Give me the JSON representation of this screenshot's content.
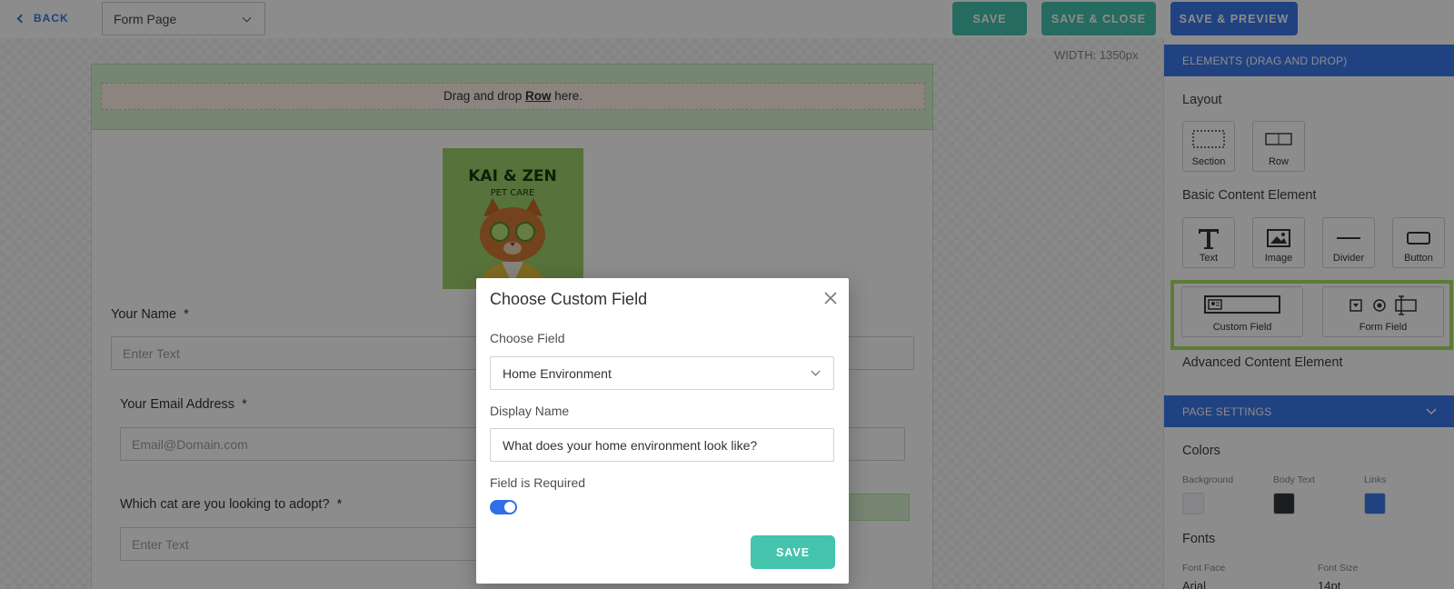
{
  "topbar": {
    "back_label": "BACK",
    "page_select_value": "Form Page",
    "save_label": "SAVE",
    "save_close_label": "SAVE & CLOSE",
    "save_preview_label": "SAVE & PREVIEW"
  },
  "canvas": {
    "width_label": "WIDTH: 1350px",
    "dropzone_prefix": "Drag and drop ",
    "dropzone_bold": "Row",
    "dropzone_suffix": " here.",
    "logo_line1": "KAI & ZEN",
    "logo_line2": "PET CARE",
    "fields": [
      {
        "label": "Your Name",
        "required": "*",
        "placeholder": "Enter Text"
      },
      {
        "label": "Your Email Address",
        "required": "*",
        "placeholder": "Email@Domain.com"
      },
      {
        "label": "Which cat are you looking to adopt?",
        "required": "*",
        "placeholder": "Enter Text"
      }
    ]
  },
  "sidebar": {
    "elements_header": "ELEMENTS (DRAG AND DROP)",
    "layout_title": "Layout",
    "layout_items": [
      "Section",
      "Row"
    ],
    "basic_title": "Basic Content Element",
    "basic_items": [
      "Text",
      "Image",
      "Divider",
      "Button"
    ],
    "custom_items": [
      "Custom Field",
      "Form Field"
    ],
    "advanced_title": "Advanced Content Element",
    "page_settings_header": "PAGE SETTINGS",
    "colors_title": "Colors",
    "color_labels": [
      "Background",
      "Body Text",
      "Links"
    ],
    "color_values": [
      "#f4f5f7",
      "#33363b",
      "#3d78eb"
    ],
    "fonts_title": "Fonts",
    "font_face_label": "Font Face",
    "font_face_value": "Arial",
    "font_size_label": "Font Size",
    "font_size_value": "14pt"
  },
  "modal": {
    "title": "Choose Custom Field",
    "choose_field_label": "Choose Field",
    "choose_field_value": "Home Environment",
    "display_name_label": "Display Name",
    "display_name_value": "What does your home environment look like?",
    "required_label": "Field is Required",
    "required_on": true,
    "save_label": "SAVE"
  },
  "colors": {
    "accent_green": "#45c4ad",
    "accent_blue": "#3d78eb",
    "highlight": "#a8e063"
  }
}
